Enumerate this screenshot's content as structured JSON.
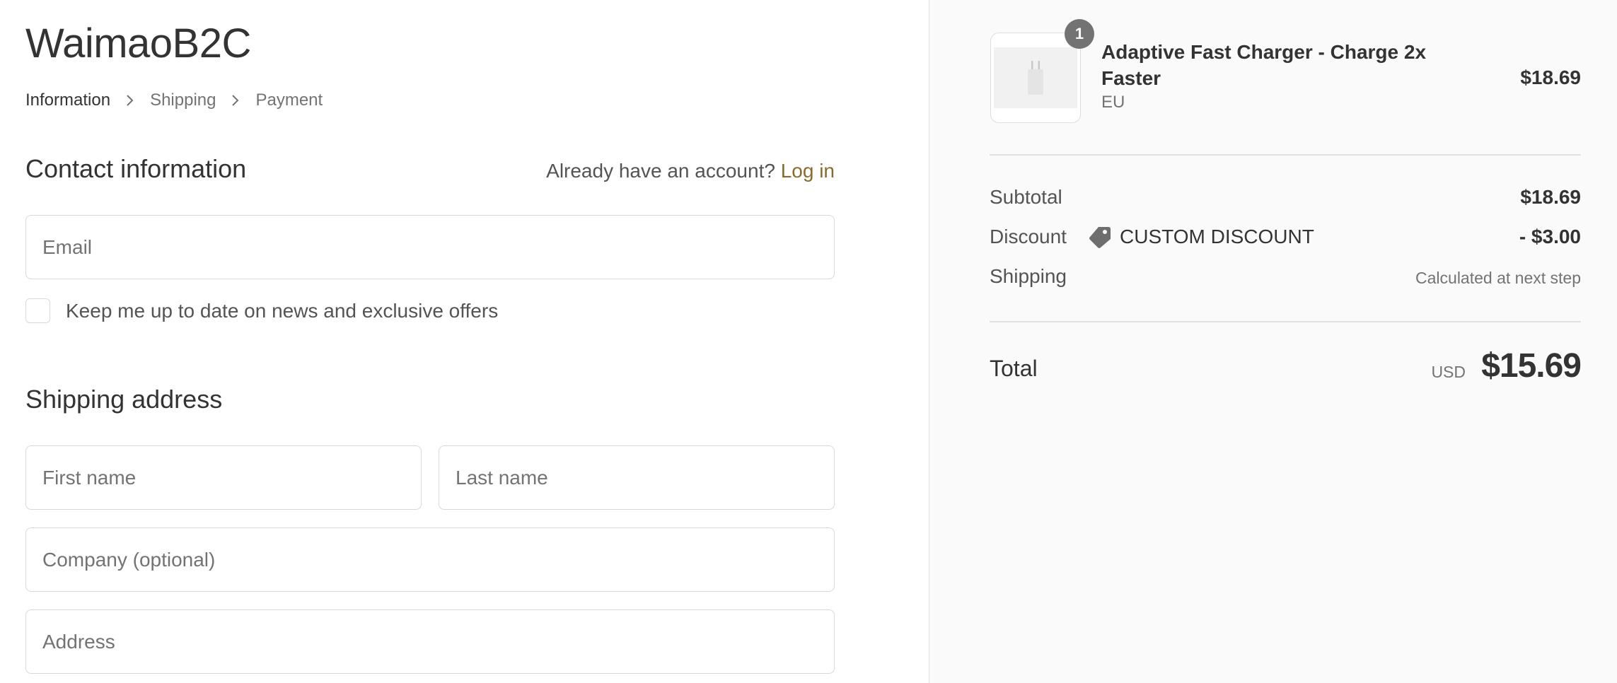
{
  "store": {
    "name": "WaimaoB2C"
  },
  "breadcrumb": [
    {
      "label": "Information",
      "current": true
    },
    {
      "label": "Shipping",
      "current": false
    },
    {
      "label": "Payment",
      "current": false
    }
  ],
  "contact": {
    "title": "Contact information",
    "account_prompt": "Already have an account?",
    "login_label": "Log in",
    "email_placeholder": "Email",
    "email_value": "",
    "newsletter_label": "Keep me up to date on news and exclusive offers",
    "newsletter_checked": false
  },
  "shipping_address": {
    "title": "Shipping address",
    "first_name_placeholder": "First name",
    "last_name_placeholder": "Last name",
    "company_placeholder": "Company (optional)",
    "address_placeholder": "Address"
  },
  "cart": {
    "items": [
      {
        "quantity": "1",
        "name": "Adaptive Fast Charger - Charge 2x Faster",
        "variant": "EU",
        "price": "$18.69",
        "image_icon": "charger-icon"
      }
    ]
  },
  "summary": {
    "subtotal_label": "Subtotal",
    "subtotal_value": "$18.69",
    "discount_label": "Discount",
    "discount_code": "CUSTOM DISCOUNT",
    "discount_icon": "tag-icon",
    "discount_value": "- $3.00",
    "shipping_label": "Shipping",
    "shipping_value": "Calculated at next step",
    "total_label": "Total",
    "currency": "USD",
    "total_value": "$15.69"
  },
  "colors": {
    "link": "#8c6a2c",
    "sidebar_bg": "#fafafa",
    "border": "#d9d9d9",
    "badge": "#737373"
  }
}
